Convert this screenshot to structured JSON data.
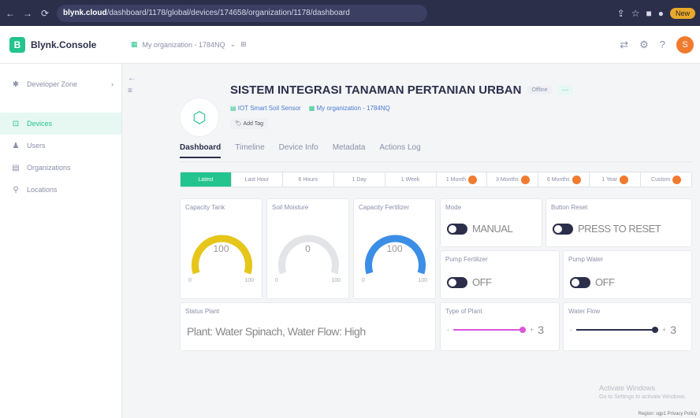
{
  "browser": {
    "url_host": "blynk.cloud",
    "url_path": "/dashboard/1178/global/devices/174658/organization/1178/dashboard",
    "new_label": "New"
  },
  "app": {
    "logo": "Blynk.Console",
    "org_selector": "My organization - 1784NQ"
  },
  "sidebar": {
    "items": [
      {
        "label": "Developer Zone",
        "icon": "code"
      },
      {
        "label": "Devices",
        "icon": "devices",
        "active": true
      },
      {
        "label": "Users",
        "icon": "users"
      },
      {
        "label": "Organizations",
        "icon": "org"
      },
      {
        "label": "Locations",
        "icon": "location"
      }
    ]
  },
  "device": {
    "title": "SISTEM INTEGRASI TANAMAN PERTANIAN URBAN",
    "status": "Offline",
    "template": "IOT Smart Soil Sensor",
    "org": "My organization - 1784NQ",
    "add_tag": "Add Tag"
  },
  "tabs": [
    "Dashboard",
    "Timeline",
    "Device Info",
    "Metadata",
    "Actions Log"
  ],
  "ranges": [
    {
      "label": "Latest",
      "active": true
    },
    {
      "label": "Last Hour"
    },
    {
      "label": "6 Hours"
    },
    {
      "label": "1 Day"
    },
    {
      "label": "1 Week"
    },
    {
      "label": "1 Month",
      "pro": true
    },
    {
      "label": "3 Months",
      "pro": true
    },
    {
      "label": "6 Months",
      "pro": true
    },
    {
      "label": "1 Year",
      "pro": true
    },
    {
      "label": "Custom",
      "pro": true
    }
  ],
  "gauges": [
    {
      "label": "Capacity Tank",
      "value": "100",
      "min": "0",
      "max": "100",
      "fill": 1.0,
      "color": "#e6c619"
    },
    {
      "label": "Soil Moisture",
      "value": "0",
      "min": "0",
      "max": "100",
      "fill": 0.0,
      "color": "#d6d8dc"
    },
    {
      "label": "Capacity Fertilizer",
      "value": "100",
      "min": "0",
      "max": "100",
      "fill": 1.0,
      "color": "#3b8ee6"
    }
  ],
  "switches": {
    "mode": {
      "label": "Mode",
      "state": "MANUAL"
    },
    "button_reset": {
      "label": "Button Reset",
      "state": "PRESS TO RESET"
    },
    "pump_fertilizer": {
      "label": "Pump Fertilizer",
      "state": "OFF"
    },
    "pump_water": {
      "label": "Pump Water",
      "state": "OFF"
    }
  },
  "status_plant": {
    "label": "Status Plant",
    "value": "Plant: Water Spinach, Water Flow: High"
  },
  "sliders": {
    "type_of_plant": {
      "label": "Type of Plant",
      "value": "3",
      "minus": "-",
      "plus": "+",
      "color": "#d957d9"
    },
    "water_flow": {
      "label": "Water Flow",
      "value": "3",
      "minus": "-",
      "plus": "+",
      "color": "#2b2f4a"
    }
  },
  "watermark": {
    "line1": "Activate Windows",
    "line2": "Go to Settings to activate Windows."
  },
  "footer": {
    "text": "Region: sgp1   Privacy Policy"
  }
}
